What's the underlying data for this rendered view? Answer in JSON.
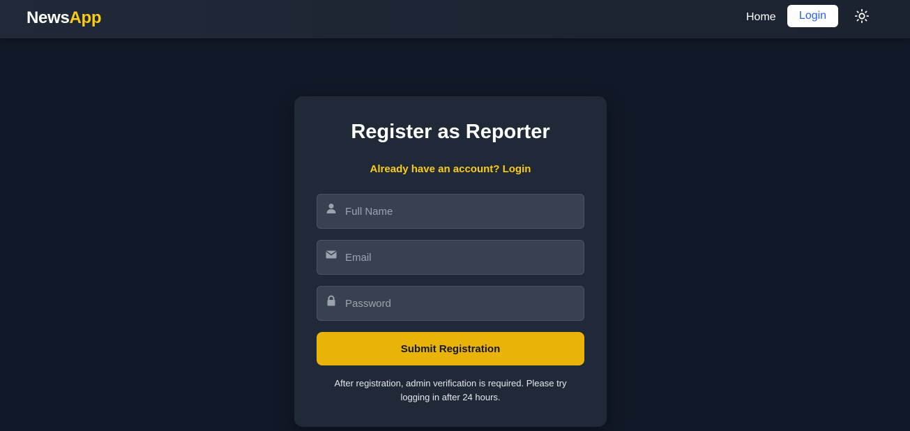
{
  "navbar": {
    "brand_part1": "News",
    "brand_part2": "App",
    "home_label": "Home",
    "login_label": "Login",
    "theme_icon": "sun-icon"
  },
  "register": {
    "title": "Register as Reporter",
    "login_link": "Already have an account? Login",
    "fields": {
      "full_name": {
        "placeholder": "Full Name",
        "value": "",
        "icon": "user-icon"
      },
      "email": {
        "placeholder": "Email",
        "value": "",
        "icon": "envelope-icon"
      },
      "password": {
        "placeholder": "Password",
        "value": "",
        "icon": "lock-icon"
      }
    },
    "submit_label": "Submit Registration",
    "note": "After registration, admin verification is required. Please try logging in after 24 hours."
  },
  "colors": {
    "background": "#111827",
    "navbar": "#1f2937",
    "card": "#1f2937",
    "accent": "#facc15",
    "button": "#eab308",
    "link_blue": "#2563eb"
  }
}
